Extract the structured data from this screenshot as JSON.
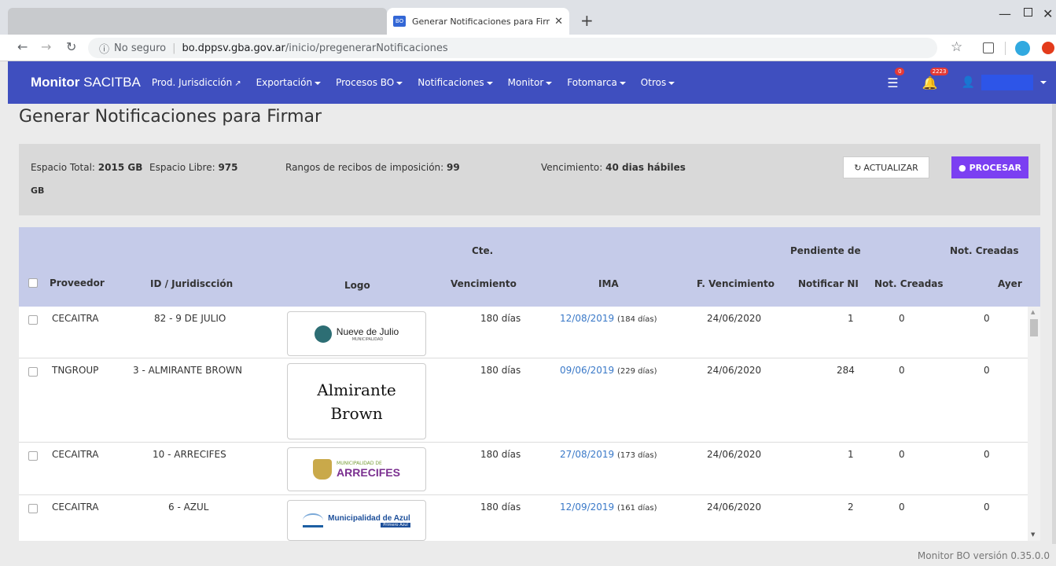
{
  "browser": {
    "tab_title": "Generar Notificaciones para Firmar",
    "tab_favicon": "BO",
    "url_secure_label": "No seguro",
    "url_host": "bo.dppsv.gba.gov.ar",
    "url_path": "/inicio/pregenerarNotificaciones"
  },
  "navbar": {
    "brand_bold": "Monitor",
    "brand_rest": "SACITBA",
    "menu": [
      {
        "label": "Prod. Jurisdicción",
        "external": true
      },
      {
        "label": "Exportación",
        "dropdown": true
      },
      {
        "label": "Procesos BO",
        "dropdown": true
      },
      {
        "label": "Notificaciones",
        "dropdown": true
      },
      {
        "label": "Monitor",
        "dropdown": true
      },
      {
        "label": "Fotomarca",
        "dropdown": true
      },
      {
        "label": "Otros",
        "dropdown": true
      }
    ],
    "messages_badge": "0",
    "alerts_badge": "2223"
  },
  "page": {
    "title": "Generar Notificaciones para Firmar"
  },
  "info": {
    "espacio_total_label": "Espacio Total:",
    "espacio_total_value": "2015 GB",
    "espacio_libre_label": "Espacio Libre:",
    "espacio_libre_value": "975",
    "espacio_libre_unit": "GB",
    "rangos_label": "Rangos de recibos de imposición:",
    "rangos_value": "99",
    "vencimiento_label": "Vencimiento:",
    "vencimiento_value": "40 dias hábiles",
    "btn_actualizar": "ACTUALIZAR",
    "btn_procesar": "PROCESAR"
  },
  "table": {
    "headers": {
      "proveedor": "Proveedor",
      "id": "ID / Juridiscción",
      "logo": "Logo",
      "cte_top": "Cte.",
      "cte_bottom": "Vencimiento",
      "ima": "IMA",
      "fvenc": "F. Vencimiento",
      "pend_top": "Pendiente de",
      "pend_bottom": "Notificar NI",
      "notcreadas": "Not. Creadas",
      "ayer_top": "Not. Creadas",
      "ayer_bottom": "Ayer"
    },
    "rows": [
      {
        "proveedor": "CECAITRA",
        "id": "82 - 9 DE JULIO",
        "logo_text": "Nueve de Julio",
        "logo_sub": "MUNICIPALIDAD",
        "cte": "180 días",
        "ima_date": "12/08/2019",
        "ima_days": "(184 días)",
        "fvenc": "24/06/2020",
        "pendiente": "1",
        "creadas": "0",
        "ayer": "0"
      },
      {
        "proveedor": "TNGROUP",
        "id": "3 - ALMIRANTE BROWN",
        "logo_text": "Almirante",
        "logo_sub": "Brown",
        "cte": "180 días",
        "ima_date": "09/06/2019",
        "ima_days": "(229 días)",
        "fvenc": "24/06/2020",
        "pendiente": "284",
        "creadas": "0",
        "ayer": "0"
      },
      {
        "proveedor": "CECAITRA",
        "id": "10 - ARRECIFES",
        "logo_text": "ARRECIFES",
        "logo_sub": "MUNICIPALIDAD DE",
        "cte": "180 días",
        "ima_date": "27/08/2019",
        "ima_days": "(173 días)",
        "fvenc": "24/06/2020",
        "pendiente": "1",
        "creadas": "0",
        "ayer": "0"
      },
      {
        "proveedor": "CECAITRA",
        "id": "6 - AZUL",
        "logo_text": "Municipalidad de Azul",
        "logo_sub": "Primero Azul",
        "cte": "180 días",
        "ima_date": "12/09/2019",
        "ima_days": "(161 días)",
        "fvenc": "24/06/2020",
        "pendiente": "2",
        "creadas": "0",
        "ayer": "0"
      }
    ]
  },
  "footer": {
    "version": "Monitor BO versión 0.35.0.0"
  },
  "colors": {
    "navbar": "#3f4fbf",
    "table_header": "#c5cbe9",
    "procesar": "#7b3ff2",
    "link": "#3a79c8"
  }
}
